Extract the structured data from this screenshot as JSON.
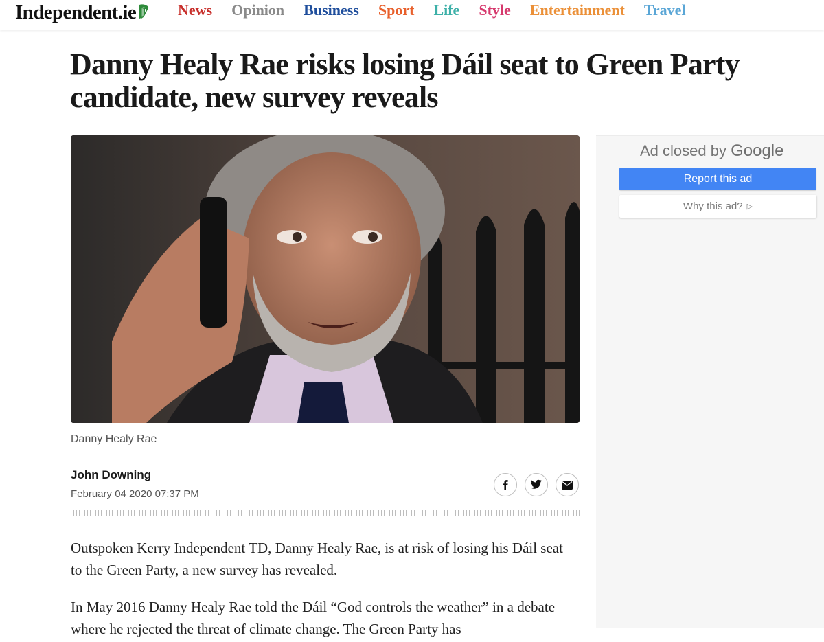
{
  "site": {
    "logo_text": "Independent.ie",
    "logo_icon": "harp-icon"
  },
  "nav": [
    {
      "label": "News",
      "color": "#c8302c"
    },
    {
      "label": "Opinion",
      "color": "#8a8a8a"
    },
    {
      "label": "Business",
      "color": "#1f4e9c"
    },
    {
      "label": "Sport",
      "color": "#e8602c"
    },
    {
      "label": "Life",
      "color": "#3cb0a8"
    },
    {
      "label": "Style",
      "color": "#d6396d"
    },
    {
      "label": "Entertainment",
      "color": "#eb9038"
    },
    {
      "label": "Travel",
      "color": "#5aa6d6"
    }
  ],
  "article": {
    "headline": "Danny Healy Rae risks losing Dáil seat to Green Party candidate, new survey reveals",
    "image_caption": "Danny Healy Rae",
    "author": "John Downing",
    "date": "February 04 2020 07:37 PM",
    "share_icons": [
      "facebook-icon",
      "twitter-icon",
      "email-icon"
    ],
    "paragraphs": [
      "Outspoken Kerry Independent TD, Danny Healy Rae, is at risk of losing his Dáil seat to the Green Party, a new survey has revealed.",
      "In May 2016 Danny Healy Rae told the Dáil “God controls the weather” in a debate where he rejected the threat of climate change. The Green Party has"
    ]
  },
  "ad": {
    "closed_prefix": "Ad closed by",
    "closed_brand": "Google",
    "report_label": "Report this ad",
    "why_label": "Why this ad?",
    "report_color": "#4285f4"
  }
}
